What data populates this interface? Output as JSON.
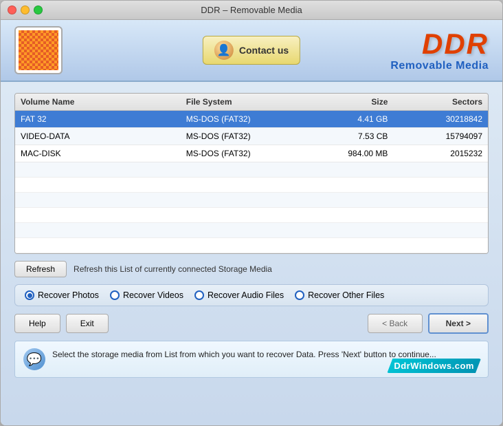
{
  "window": {
    "title": "DDR – Removable Media"
  },
  "header": {
    "contact_btn_label": "Contact us",
    "brand_ddr": "DDR",
    "brand_sub": "Removable Media"
  },
  "table": {
    "columns": [
      "Volume Name",
      "File System",
      "Size",
      "Sectors"
    ],
    "rows": [
      {
        "volume": "FAT 32",
        "fs": "MS-DOS (FAT32)",
        "size": "4.41 GB",
        "sectors": "30218842",
        "selected": true
      },
      {
        "volume": "VIDEO-DATA",
        "fs": "MS-DOS (FAT32)",
        "size": "7.53  CB",
        "sectors": "15794097",
        "selected": false
      },
      {
        "volume": "MAC-DISK",
        "fs": "MS-DOS (FAT32)",
        "size": "984.00  MB",
        "sectors": "2015232",
        "selected": false
      }
    ]
  },
  "refresh": {
    "btn_label": "Refresh",
    "description": "Refresh this List of currently connected Storage Media"
  },
  "recovery_options": [
    {
      "id": "photos",
      "label": "Recover Photos",
      "checked": true
    },
    {
      "id": "videos",
      "label": "Recover Videos",
      "checked": false
    },
    {
      "id": "audio",
      "label": "Recover Audio Files",
      "checked": false
    },
    {
      "id": "other",
      "label": "Recover Other Files",
      "checked": false
    }
  ],
  "buttons": {
    "help": "Help",
    "exit": "Exit",
    "back": "< Back",
    "next": "Next >"
  },
  "info": {
    "text": "Select the storage media from List from which you want to recover Data. Press 'Next' button to continue..."
  },
  "watermark": {
    "label": "DdrWindows.com"
  }
}
